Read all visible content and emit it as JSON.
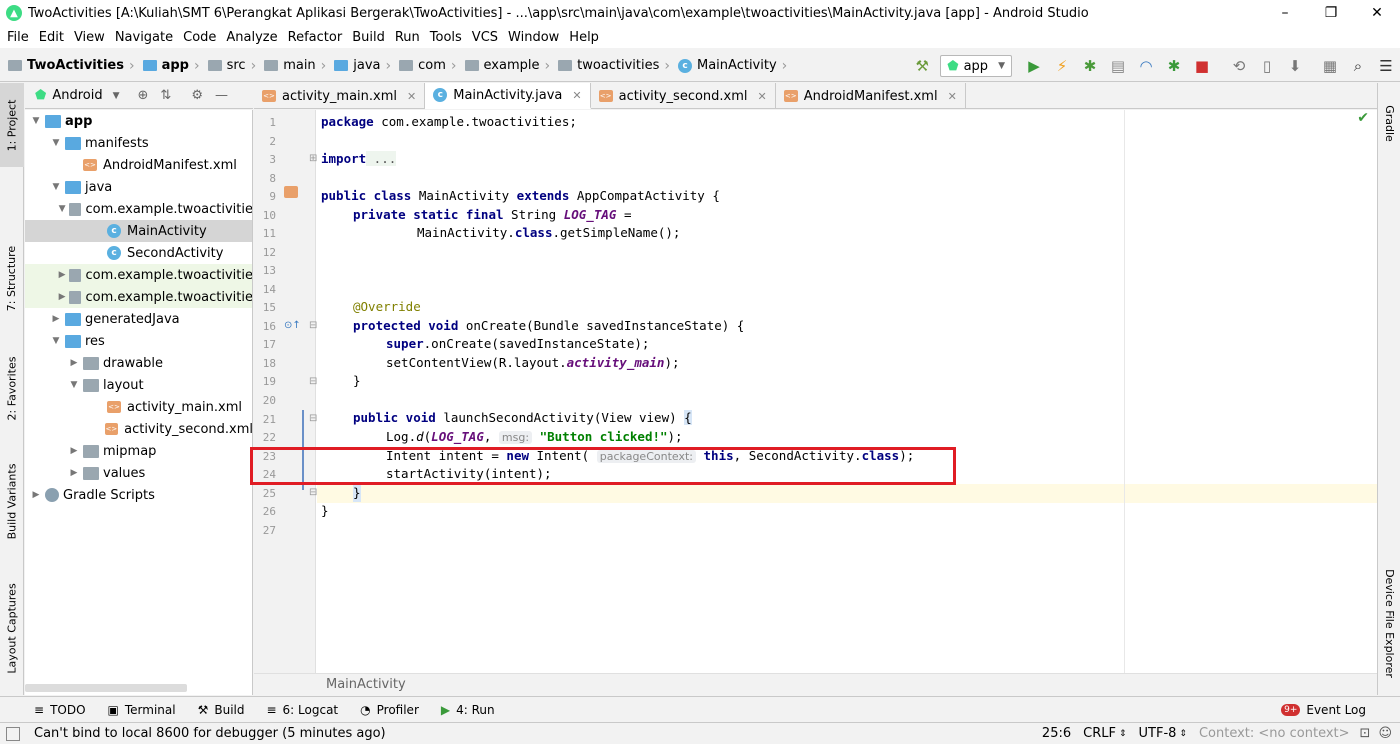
{
  "window": {
    "title": "TwoActivities [A:\\Kuliah\\SMT 6\\Perangkat Aplikasi Bergerak\\TwoActivities] - ...\\app\\src\\main\\java\\com\\example\\twoactivities\\MainActivity.java [app] - Android Studio",
    "controls": [
      "–",
      "❐",
      "✕"
    ]
  },
  "menu": [
    "File",
    "Edit",
    "View",
    "Navigate",
    "Code",
    "Analyze",
    "Refactor",
    "Build",
    "Run",
    "Tools",
    "VCS",
    "Window",
    "Help"
  ],
  "breadcrumb": [
    "TwoActivities",
    "app",
    "src",
    "main",
    "java",
    "com",
    "example",
    "twoactivities",
    "MainActivity"
  ],
  "toolbar": {
    "config": "app"
  },
  "project_panel": {
    "view": "Android",
    "tree": [
      {
        "label": "app",
        "level": 0,
        "icon": "module",
        "expanded": true,
        "bold": true
      },
      {
        "label": "manifests",
        "level": 1,
        "icon": "folder",
        "expanded": true
      },
      {
        "label": "AndroidManifest.xml",
        "level": 2,
        "icon": "xml"
      },
      {
        "label": "java",
        "level": 1,
        "icon": "folder",
        "expanded": true
      },
      {
        "label": "com.example.twoactivitie",
        "level": 2,
        "icon": "package",
        "expanded": true
      },
      {
        "label": "MainActivity",
        "level": 3,
        "icon": "class",
        "selected": true
      },
      {
        "label": "SecondActivity",
        "level": 3,
        "icon": "class"
      },
      {
        "label": "com.example.twoactivitie",
        "level": 2,
        "icon": "package",
        "expanded": false,
        "tint": true
      },
      {
        "label": "com.example.twoactivitie",
        "level": 2,
        "icon": "package",
        "expanded": false,
        "tint": true
      },
      {
        "label": "generatedJava",
        "level": 1,
        "icon": "folder",
        "expanded": false
      },
      {
        "label": "res",
        "level": 1,
        "icon": "folder",
        "expanded": true
      },
      {
        "label": "drawable",
        "level": 2,
        "icon": "folder",
        "expanded": false
      },
      {
        "label": "layout",
        "level": 2,
        "icon": "folder",
        "expanded": true
      },
      {
        "label": "activity_main.xml",
        "level": 3,
        "icon": "xml"
      },
      {
        "label": "activity_second.xml",
        "level": 3,
        "icon": "xml"
      },
      {
        "label": "mipmap",
        "level": 2,
        "icon": "folder",
        "expanded": false
      },
      {
        "label": "values",
        "level": 2,
        "icon": "folder",
        "expanded": false
      },
      {
        "label": "Gradle Scripts",
        "level": 0,
        "icon": "gradle",
        "expanded": false
      }
    ]
  },
  "left_tool_tabs": [
    "1: Project",
    "7: Structure",
    "2: Favorites",
    "Build Variants",
    "Layout Captures"
  ],
  "right_tool_tabs": [
    "Gradle",
    "Device File Explorer"
  ],
  "editor_tabs": [
    {
      "label": "activity_main.xml",
      "type": "xml",
      "active": false
    },
    {
      "label": "MainActivity.java",
      "type": "class",
      "active": true
    },
    {
      "label": "activity_second.xml",
      "type": "xml",
      "active": false
    },
    {
      "label": "AndroidManifest.xml",
      "type": "manifest",
      "active": false
    }
  ],
  "editor": {
    "line_numbers": [
      "1",
      "2",
      "3",
      "8",
      "9",
      "10",
      "11",
      "12",
      "13",
      "14",
      "15",
      "16",
      "17",
      "18",
      "19",
      "20",
      "21",
      "22",
      "23",
      "24",
      "25",
      "26",
      "27"
    ],
    "lines": {
      "l1": {
        "kw": "package",
        "rest": " com.example.twoactivities;"
      },
      "l3": {
        "kw": "import",
        "rest": " ..."
      },
      "l9": {
        "kw1": "public class",
        "mid": " MainActivity ",
        "kw2": "extends",
        "rest": " AppCompatActivity {"
      },
      "l10": {
        "kw": "private static final",
        "mid": " String ",
        "fld": "LOG_TAG",
        "rest": " ="
      },
      "l11": {
        "mid": "MainActivity.",
        "kw": "class",
        "rest": ".getSimpleName();"
      },
      "l15": {
        "ann": "@Override"
      },
      "l16": {
        "kw": "protected void",
        "rest": " onCreate(Bundle savedInstanceState) {"
      },
      "l17": {
        "kw": "super",
        "rest": ".onCreate(savedInstanceState);"
      },
      "l18": {
        "pre": "setContentView(R.layout.",
        "fld": "activity_main",
        "rest": ");"
      },
      "l19": {
        "rest": "}"
      },
      "l21": {
        "kw": "public void",
        "rest": " launchSecondActivity(View view) ",
        "brace": "{"
      },
      "l22": {
        "pre": "Log.",
        "fn": "d",
        "p2": "(",
        "fld": "LOG_TAG",
        "p3": ",",
        "hint": "msg:",
        "str": "\"Button clicked!\"",
        "rest": ");"
      },
      "l23": {
        "pre": "Intent intent = ",
        "kw": "new",
        "mid": " Intent(",
        "hint": "packageContext:",
        "kw2": "this",
        "mid2": ", SecondActivity.",
        "kw3": "class",
        "rest": ");"
      },
      "l24": {
        "rest": "startActivity(intent);"
      },
      "l25": {
        "rest": "}"
      },
      "l26": {
        "rest": "}"
      }
    },
    "footer_breadcrumb": "MainActivity"
  },
  "bottom_tools": [
    {
      "icon": "≡",
      "label": "TODO"
    },
    {
      "icon": "▣",
      "label": "Terminal"
    },
    {
      "icon": "⚒",
      "label": "Build"
    },
    {
      "icon": "≡",
      "label": "6: Logcat"
    },
    {
      "icon": "◔",
      "label": "Profiler"
    },
    {
      "icon": "▶",
      "label": "4: Run"
    }
  ],
  "event_log": {
    "badge": "9+",
    "label": "Event Log"
  },
  "status": {
    "message": "Can't bind to local 8600 for debugger (5 minutes ago)",
    "position": "25:6",
    "line_sep": "CRLF",
    "encoding": "UTF-8",
    "context": "Context: <no context>"
  },
  "colors": {
    "highlight_box": "#e01c24",
    "keyword": "#000080",
    "string": "#008000",
    "annotation": "#808000",
    "field": "#660e7a",
    "current_line": "#fffae3"
  }
}
